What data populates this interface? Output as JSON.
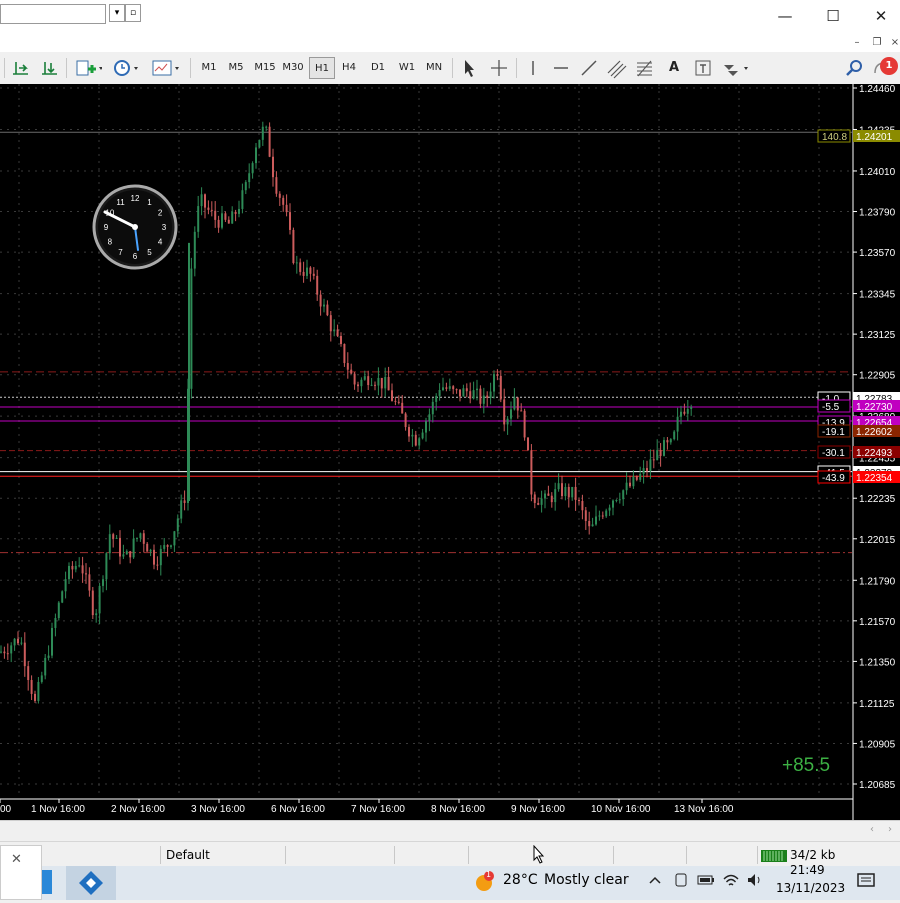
{
  "window": {
    "minimize_glyph": "—",
    "maximize_glyph": "☐",
    "close_glyph": "✕",
    "combo_arrow": "▾",
    "restore_glyph": "▫"
  },
  "mdi": {
    "minimize_glyph": "–",
    "restore_glyph": "❐",
    "close_glyph": "×"
  },
  "toolbar": {
    "timeframes": [
      "M1",
      "M5",
      "M15",
      "M30",
      "H1",
      "H4",
      "D1",
      "W1",
      "MN"
    ],
    "active_timeframe": "H1",
    "text_tool_label": "A",
    "notification_count": "1"
  },
  "chart": {
    "background": "#000000",
    "bull_color": "#2e8b57",
    "bear_color": "#cd5c5c",
    "grid_color": "#3a3a3a",
    "profit_display": "+85.5",
    "price_axis_ticks": [
      "1.24460",
      "1.24235",
      "1.24010",
      "1.23790",
      "1.23570",
      "1.23345",
      "1.23125",
      "1.22905",
      "1.22680",
      "1.22455",
      "1.22235",
      "1.22015",
      "1.21790",
      "1.21570",
      "1.21350",
      "1.21125",
      "1.20905",
      "1.20685"
    ],
    "time_axis_ticks": [
      "00",
      "1 Nov 16:00",
      "2 Nov 16:00",
      "3 Nov 16:00",
      "6 Nov 16:00",
      "7 Nov 16:00",
      "8 Nov 16:00",
      "9 Nov 16:00",
      "10 Nov 16:00",
      "13 Nov 16:00"
    ],
    "price_tags": [
      {
        "label": "140.8",
        "price": "1.24201",
        "color": "#8b8b00"
      },
      {
        "label": "-1.0",
        "price": "1.22783",
        "color": "#ffffff"
      },
      {
        "label": "-5.5",
        "price": "1.22730",
        "color": "#c000c0"
      },
      {
        "label": "-13.9",
        "price": "1.22654",
        "color": "#c000c0"
      },
      {
        "label": "-19.1",
        "price": "1.22602",
        "color": "#8b2500"
      },
      {
        "label": "-30.1",
        "price": "1.22493",
        "color": "#8b0000"
      },
      {
        "label": "-41.5",
        "price": "1.22379",
        "color": "#ffffff"
      },
      {
        "label": "-43.9",
        "price": "1.22354",
        "color": "#ff0000"
      }
    ],
    "clock_numbers": [
      "12",
      "1",
      "2",
      "3",
      "4",
      "5",
      "6",
      "7",
      "8",
      "9",
      "10",
      "11"
    ]
  },
  "statusbar": {
    "profile": "Default",
    "traffic": "34/2 kb"
  },
  "taskbar": {
    "weather_temp": "28°C",
    "weather_text": "Mostly clear",
    "time": "21:49",
    "date": "13/11/2023",
    "weather_badge": "1"
  }
}
